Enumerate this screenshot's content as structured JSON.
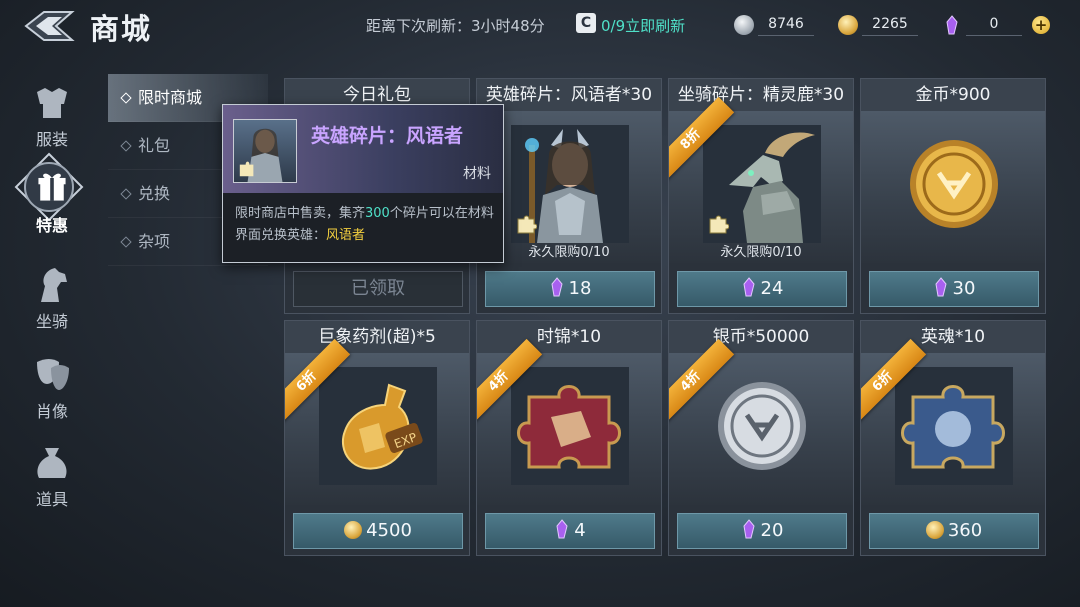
{
  "header": {
    "title": "商城",
    "refresh_text": "距离下次刷新：3小时48分",
    "refresh_icon_letter": "C",
    "refresh_button": "0/9立即刷新",
    "currencies": [
      {
        "icon": "silver-coin-icon",
        "value": "8746"
      },
      {
        "icon": "gold-coin-icon",
        "value": "2265"
      },
      {
        "icon": "purple-crystal-icon",
        "value": "0"
      }
    ],
    "plus_label": "+"
  },
  "rail": {
    "items": [
      {
        "icon": "armor-icon",
        "label": "服装"
      },
      {
        "icon": "gift-icon",
        "label": "特惠",
        "active": true
      },
      {
        "icon": "horse-icon",
        "label": "坐骑"
      },
      {
        "icon": "mask-icon",
        "label": "肖像"
      },
      {
        "icon": "bag-icon",
        "label": "道具"
      }
    ]
  },
  "submenu": {
    "items": [
      "限时商城",
      "礼包",
      "兑换",
      "杂项"
    ],
    "active_index": 0
  },
  "cards": [
    {
      "title": "今日礼包",
      "claimed_label": "已领取"
    },
    {
      "title": "英雄碎片：风语者*30",
      "limit": "永久限购0/10",
      "currency": "crystal",
      "price": "18"
    },
    {
      "title": "坐骑碎片：精灵鹿*30",
      "discount": "8折",
      "limit": "永久限购0/10",
      "currency": "crystal",
      "price": "24"
    },
    {
      "title": "金币*900",
      "currency": "crystal",
      "price": "30"
    },
    {
      "title": "巨象药剂(超)*5",
      "discount": "6折",
      "currency": "gold",
      "price": "4500"
    },
    {
      "title": "时锦*10",
      "discount": "4折",
      "currency": "crystal",
      "price": "4"
    },
    {
      "title": "银币*50000",
      "discount": "4折",
      "currency": "crystal",
      "price": "20"
    },
    {
      "title": "英魂*10",
      "discount": "6折",
      "currency": "gold",
      "price": "360"
    }
  ],
  "tooltip": {
    "name": "英雄碎片：风语者",
    "type": "材料",
    "desc_part1": "限时商店中售卖，集齐",
    "desc_num": "300",
    "desc_part2": "个碎片可以在材料界面兑换英雄：",
    "desc_hero": "风语者"
  },
  "colors": {
    "accent_teal": "#4fe0c8",
    "tooltip_name": "#c9a4ff",
    "highlight_yellow": "#f4d03f",
    "discount_orange": "#e89a22"
  }
}
